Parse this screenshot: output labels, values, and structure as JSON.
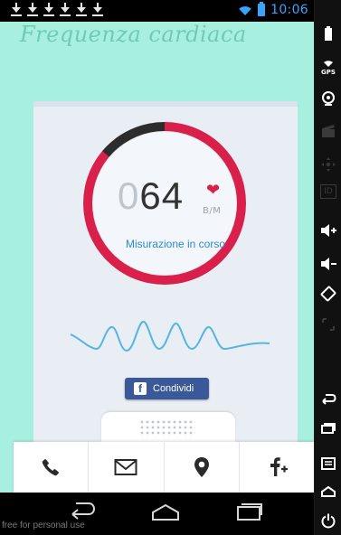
{
  "status_bar": {
    "time": "10:06",
    "download_icons": [
      "download-icon",
      "download-icon",
      "download-icon",
      "download-icon",
      "download-icon",
      "download-icon"
    ]
  },
  "app": {
    "title": "Frequenza cardiaca",
    "heart_rate": {
      "leading_digit": "0",
      "value_digits": "64",
      "unit": "B/M",
      "status": "Misurazione in corso"
    },
    "share_button": {
      "label": "Condividi",
      "icon": "facebook-icon"
    }
  },
  "bottom_bar": {
    "items": [
      {
        "name": "phone-icon"
      },
      {
        "name": "mail-icon"
      },
      {
        "name": "location-pin-icon"
      },
      {
        "name": "facebook-add-icon"
      }
    ]
  },
  "navigation": {
    "back": "back-icon",
    "home": "home-icon",
    "recent": "recent-apps-icon"
  },
  "watermark": "free for personal use",
  "emulator_strip": {
    "gps_label": "GPS",
    "id_label": "ID"
  },
  "colors": {
    "mint": "#a7efdf",
    "accent_red": "#d8204a",
    "accent_blue": "#2a8ad6",
    "facebook_blue": "#3b5998"
  }
}
